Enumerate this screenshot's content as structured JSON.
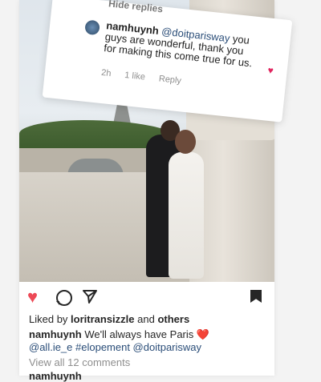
{
  "comment": {
    "hide_replies": "Hide replies",
    "username": "namhuynh",
    "mention": "@doitparisway",
    "text": "you guys are wonderful, thank you for making this come true for us.",
    "time": "2h",
    "likes": "1 like",
    "reply": "Reply",
    "avatar_icon": "avatar",
    "like_icon": "heart-icon"
  },
  "post": {
    "liked_prefix": "Liked by",
    "liked_user": "loritransizzle",
    "liked_and": "and",
    "liked_others": "others",
    "caption_user": "namhuynh",
    "caption_text": "We'll always have Paris",
    "caption_emoji": "❤️",
    "caption_mentions": "@all.ie_e #elopement @doitparisway",
    "view_comments": "View all 12 comments",
    "next_comment_user": "namhuynh"
  },
  "colors": {
    "like": "#ed4956",
    "mention": "#2a4d78"
  },
  "icons": [
    "heart-icon",
    "comment-icon",
    "share-icon",
    "bookmark-icon"
  ]
}
